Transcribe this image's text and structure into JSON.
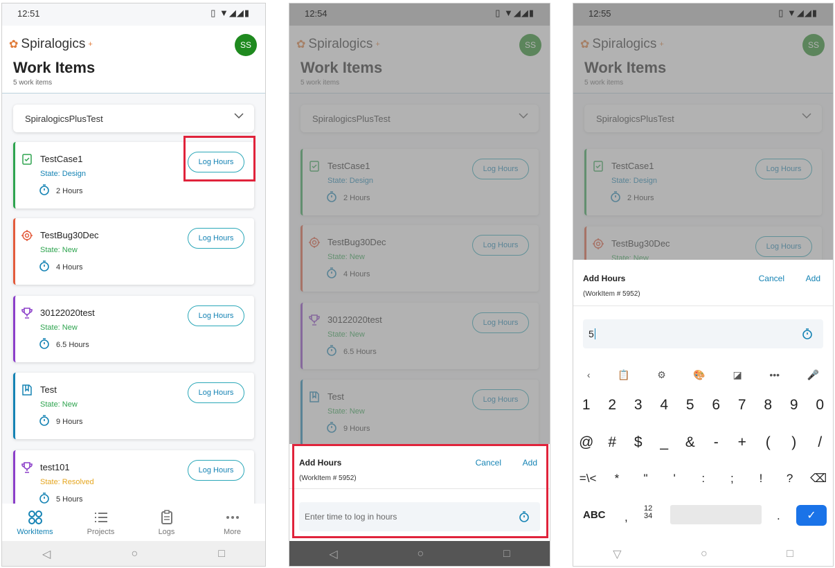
{
  "screen1": {
    "time": "12:51",
    "status_icons": "▯ ▼◢◢▮",
    "brand": "Spiralogics",
    "brand_plus": "+",
    "avatar": "SS",
    "title": "Work Items",
    "subtitle": "5 work items",
    "project": "SpiralogicsPlusTest",
    "log_label": "Log Hours",
    "cards": [
      {
        "title": "TestCase1",
        "state": "State: Design",
        "hours": "2 Hours",
        "color": "#2ea44f",
        "icon": "testcase-icon",
        "state_color": "#1583b4"
      },
      {
        "title": "TestBug30Dec",
        "state": "State: New",
        "hours": "4 Hours",
        "color": "#e35b3c",
        "icon": "bug-target-icon",
        "state_color": "#2ea44f"
      },
      {
        "title": "30122020test",
        "state": "State: New",
        "hours": "6.5 Hours",
        "color": "#8b3fc9",
        "icon": "trophy-icon",
        "state_color": "#2ea44f"
      },
      {
        "title": "Test",
        "state": "State: New",
        "hours": "9 Hours",
        "color": "#1583b4",
        "icon": "book-icon",
        "state_color": "#2ea44f"
      },
      {
        "title": "test101",
        "state": "State: Resolved",
        "hours": "5 Hours",
        "color": "#8b3fc9",
        "icon": "trophy-icon",
        "state_color": "#e5a620"
      }
    ],
    "nav": {
      "workitems": "WorkItems",
      "projects": "Projects",
      "logs": "Logs",
      "more": "More"
    }
  },
  "screen2": {
    "time": "12:54",
    "sheet": {
      "title": "Add Hours",
      "workitem": "(WorkItem # 5952)",
      "cancel": "Cancel",
      "add": "Add",
      "placeholder": "Enter time to log in hours"
    }
  },
  "screen3": {
    "time": "12:55",
    "sheet": {
      "title": "Add Hours",
      "workitem": "(WorkItem # 5952)",
      "cancel": "Cancel",
      "add": "Add",
      "value": "5"
    },
    "keyboard": {
      "toolbar": [
        "‹",
        "📋",
        "⚙",
        "🎨",
        "◪",
        "•••",
        "🎤"
      ],
      "row1": [
        "1",
        "2",
        "3",
        "4",
        "5",
        "6",
        "7",
        "8",
        "9",
        "0"
      ],
      "row2": [
        "@",
        "#",
        "$",
        "_",
        "&",
        "-",
        "+",
        "(",
        ")",
        "/"
      ],
      "row3": [
        "=\\<",
        "*",
        "\"",
        "'",
        ":",
        ";",
        "!",
        "?",
        "⌫"
      ],
      "abc": "ABC",
      "comma": ",",
      "numpad": "12\n34",
      "period": ".",
      "enter": "✓"
    }
  }
}
